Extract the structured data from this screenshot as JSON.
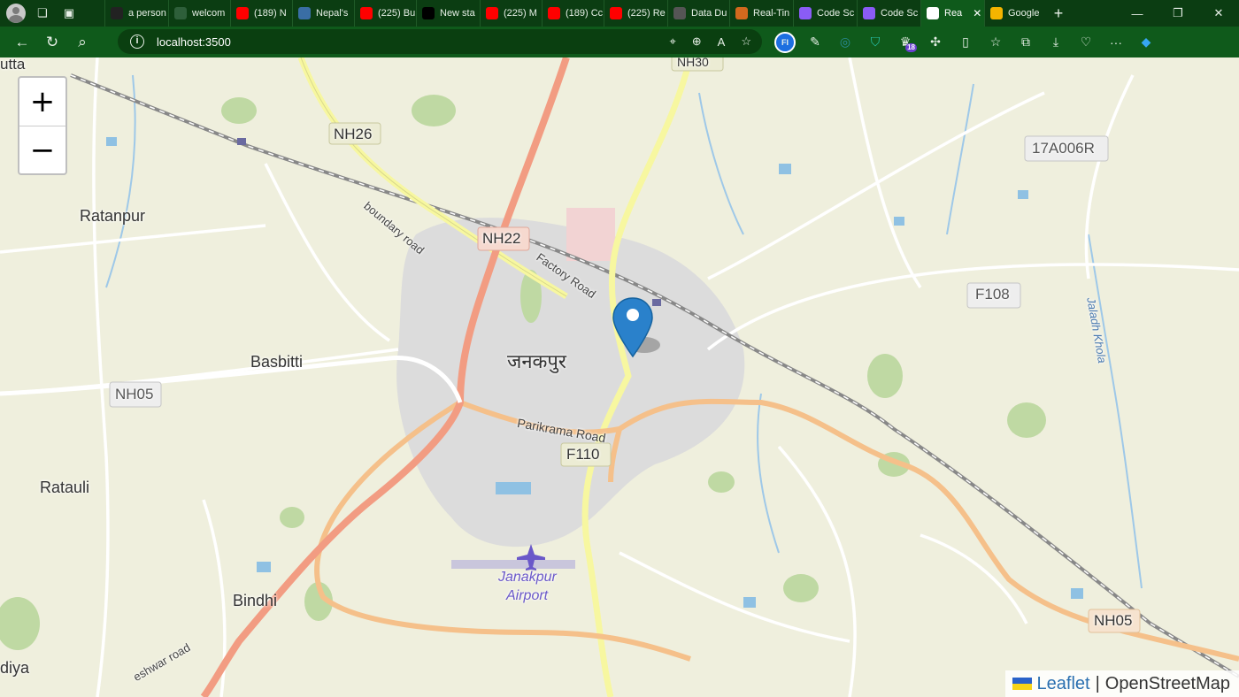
{
  "browser": {
    "tabs": [
      {
        "title": "a person",
        "favicon": "dark-page-icon",
        "color": "#222222"
      },
      {
        "title": "welcom",
        "favicon": "leaf-icon",
        "color": "#2e5f3a"
      },
      {
        "title": "(189) N",
        "favicon": "youtube-icon",
        "color": "#ff0000"
      },
      {
        "title": "Nepal's",
        "favicon": "globe-icon",
        "color": "#3a6ea5"
      },
      {
        "title": "(225) Bu",
        "favicon": "youtube-icon",
        "color": "#ff0000"
      },
      {
        "title": "New sta",
        "favicon": "medium-icon",
        "color": "#000000"
      },
      {
        "title": "(225) M",
        "favicon": "youtube-icon",
        "color": "#ff0000"
      },
      {
        "title": "(189) Cc",
        "favicon": "youtube-icon",
        "color": "#ff0000"
      },
      {
        "title": "(225) Re",
        "favicon": "youtube-icon",
        "color": "#ff0000"
      },
      {
        "title": "Data Du",
        "favicon": "gear-icon",
        "color": "#555555"
      },
      {
        "title": "Real-Tin",
        "favicon": "sun-icon",
        "color": "#d2691e"
      },
      {
        "title": "Code Sc",
        "favicon": "vite-icon",
        "color": "#8a5cf6"
      },
      {
        "title": "Code Sc",
        "favicon": "vite-icon",
        "color": "#8a5cf6"
      },
      {
        "title": "Rea",
        "favicon": "page-icon",
        "color": "#ffffff",
        "active": true
      },
      {
        "title": "Google",
        "favicon": "google-keep-icon",
        "color": "#f4b400"
      }
    ],
    "address": "localhost:3500",
    "extension_badge": "18"
  },
  "map": {
    "zoom_in": "+",
    "zoom_out": "−",
    "attribution": {
      "leaflet": "Leaflet",
      "separator": "|",
      "osm": "OpenStreetMap"
    },
    "labels": {
      "utta": "utta",
      "nh30": "NH30",
      "nh26": "NH26",
      "boundary_road": "boundary road",
      "nh22": "NH22",
      "factory_road": "Factory Road",
      "ratanpur": "Ratanpur",
      "seventeen": "17A006R",
      "f108": "F108",
      "jalad": "Jaladh Khola",
      "basbitti": "Basbitti",
      "janakpur": "जनकपुर",
      "nh05_left": "NH05",
      "parikrama": "Parikrama Road",
      "f110": "F110",
      "ratauli": "Ratauli",
      "airport": "Janakpur",
      "airport2": "Airport",
      "bindhi": "Bindhi",
      "nh05_right": "NH05",
      "diya": "diya",
      "eshwar": "eshwar road"
    }
  }
}
